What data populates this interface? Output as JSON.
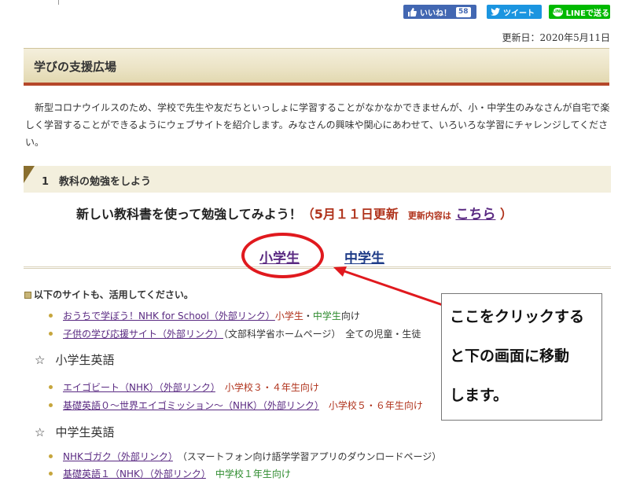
{
  "social": {
    "like_label": "いいね！",
    "like_count": "58",
    "tweet_label": "ツイート",
    "line_label": "LINEで送る"
  },
  "update_date": "更新日：2020年5月11日",
  "hero_title": "学びの支援広場",
  "intro_text": "新型コロナウイルスのため、学校で先生や友だちといっしょに学習することがなかなかできませんが、小・中学生のみなさんが自宅で楽しく学習することができるようにウェブサイトを紹介します。みなさんの興味や関心にあわせて、いろいろな学習にチャレンジしてください。",
  "section1_title": "1　教科の勉強をしよう",
  "study_line": {
    "main": "新しい教科書を使って勉強してみよう！",
    "update": "（5月１１日更新",
    "note": "更新内容は",
    "link": "こちら",
    "close": "）"
  },
  "grades": {
    "elementary": "小学生",
    "junior_high": "中学生"
  },
  "sub_note": "以下のサイトも、活用してください。",
  "links": [
    {
      "link": "おうちで学ぼう！NHK for School（外部リンク）",
      "suffix_red": "小学生",
      "suffix_sep": "・",
      "suffix_grn": "中学生",
      "suffix_tail": "向け"
    },
    {
      "link": "子供の学び応援サイト（外部リンク）",
      "suffix_plain": "（文部科学省ホームページ）　全ての児童・生徒"
    }
  ],
  "elem_english": {
    "heading_star": "☆",
    "heading": "小学生英語",
    "items": [
      {
        "link": "エイゴビート（NHK）（外部リンク）",
        "suffix_red": "小学校３・４年生向け"
      },
      {
        "link": "基礎英語０～世界エイゴミッション～（NHK）（外部リンク）",
        "suffix_red": "小学校５・６年生向け"
      }
    ]
  },
  "jh_english": {
    "heading_star": "☆",
    "heading": "中学生英語",
    "items": [
      {
        "link": "NHKゴガク（外部リンク）",
        "suffix_plain": "（スマートフォン向け語学学習アプリのダウンロードページ）"
      },
      {
        "link": "基礎英語１（NHK）（外部リンク）",
        "suffix_grn": "中学校１年生向け"
      }
    ]
  },
  "callout": {
    "line1": "ここをクリックする",
    "line2": "と下の画面に移動",
    "line3": "します。"
  },
  "colors": {
    "annotation_red": "#e0191e",
    "hero_band": "#ebe3c4",
    "accent_brown": "#b5472a",
    "link_purple": "#5a2a82"
  }
}
